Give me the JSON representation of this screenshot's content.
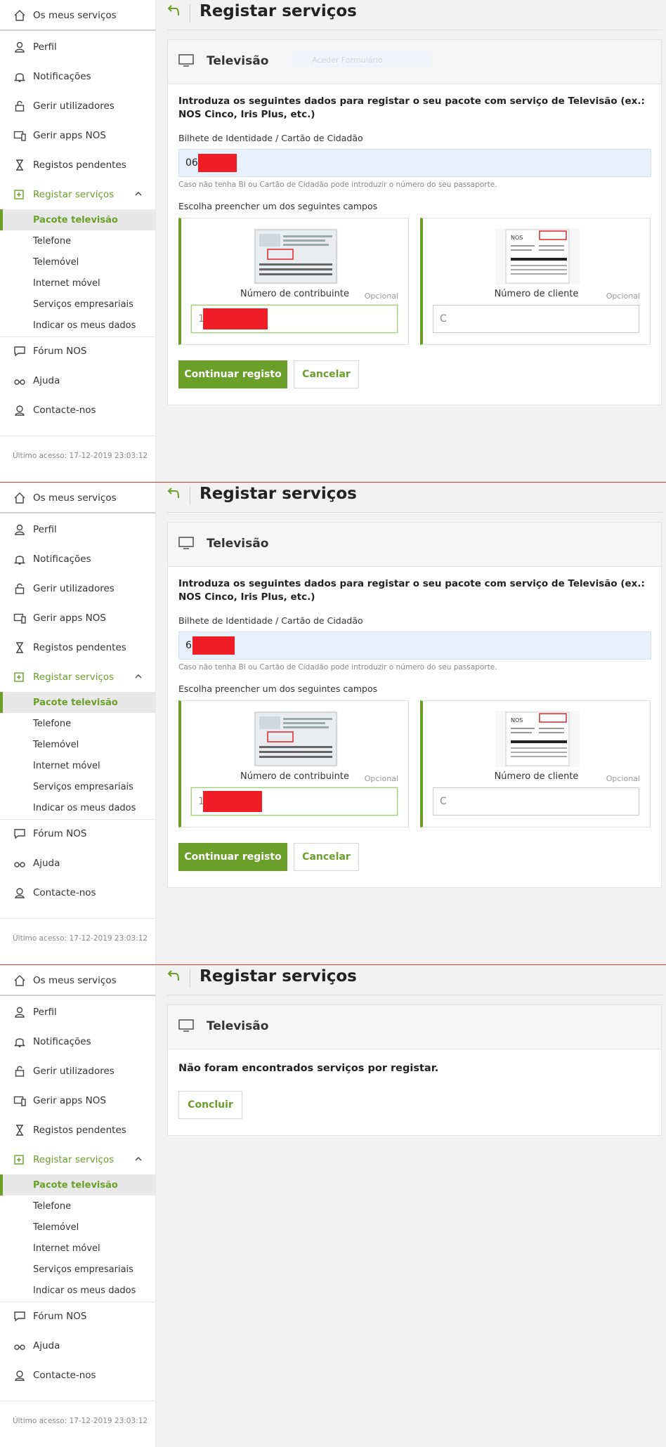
{
  "sidebar": {
    "items": [
      {
        "label": "Os meus serviços",
        "icon": "home-icon"
      },
      {
        "label": "Perfil",
        "icon": "user-icon"
      },
      {
        "label": "Notificações",
        "icon": "bell-icon"
      },
      {
        "label": "Gerir utilizadores",
        "icon": "lock-icon"
      },
      {
        "label": "Gerir apps NOS",
        "icon": "devices-icon"
      },
      {
        "label": "Registos pendentes",
        "icon": "hourglass-icon"
      },
      {
        "label": "Registar serviços",
        "icon": "register-icon"
      }
    ],
    "subitems": [
      "Pacote televisão",
      "Telefone",
      "Telemóvel",
      "Internet móvel",
      "Serviços empresariais",
      "Indicar os meus dados"
    ],
    "bottom_items": [
      {
        "label": "Fórum NOS",
        "icon": "chat-icon"
      },
      {
        "label": "Ajuda",
        "icon": "glasses-icon"
      },
      {
        "label": "Contacte-nos",
        "icon": "agent-icon"
      }
    ],
    "last_access": "Último acesso: 17-12-2019 23:03:12"
  },
  "header": {
    "title": "Registar serviços"
  },
  "card": {
    "title": "Televisão",
    "ghost_text": "Aceder Formulário",
    "intro": "Introduza os seguintes dados para registar o seu pacote com serviço de Televisão (ex.: NOS Cinco, Iris Plus, etc.)",
    "bi_label": "Bilhete de Identidade / Cartão de Cidadão",
    "hint": "Caso não tenha BI ou Cartão de Cidadão pode introduzir o número do seu passaporte.",
    "choose_label": "Escolha preencher um dos seguintes campos",
    "option_nif": "Número de contribuinte",
    "option_client": "Número de cliente",
    "optional": "Opcional",
    "continue": "Continuar registo",
    "cancel": "Cancelar",
    "empty_msg": "Não foram encontrados serviços por registar.",
    "conclude": "Concluir"
  },
  "frames": [
    {
      "bi_value": "06",
      "nif_value": "1",
      "client_value": "C"
    },
    {
      "bi_value": "6",
      "nif_value": "1",
      "client_value": "C"
    }
  ],
  "colors": {
    "accent": "#6aa02a",
    "redaction": "#ee1c24",
    "input_bg": "#e8effd"
  }
}
